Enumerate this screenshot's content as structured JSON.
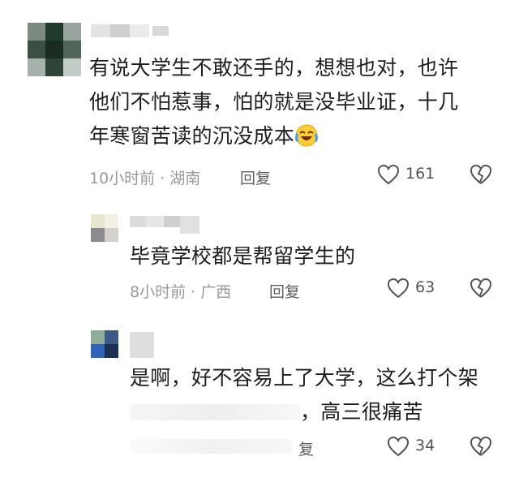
{
  "comments": [
    {
      "text_lines": [
        "有说大学生不敢还手的，想想也对，也许",
        "他们不怕惹事，怕的就是没毕业证，十几",
        "年寒窗苦读的沉没成本"
      ],
      "emoji": "laugh-cry-emoji",
      "time_location": "10小时前 · 湖南",
      "reply_label": "回复",
      "like_count": "161"
    },
    {
      "text_lines": [
        "毕竟学校都是帮留学生的"
      ],
      "time_location": "8小时前 · 广西",
      "reply_label": "回复",
      "like_count": "63"
    },
    {
      "text_lines": [
        "是啊，好不容易上了大学，这么打个架",
        "，高三很痛苦"
      ],
      "reply_label_partial": "复",
      "like_count": "34"
    }
  ],
  "colors": {
    "text": "#1e1e1e",
    "meta": "#9a9a9a",
    "icon": "#555555"
  }
}
